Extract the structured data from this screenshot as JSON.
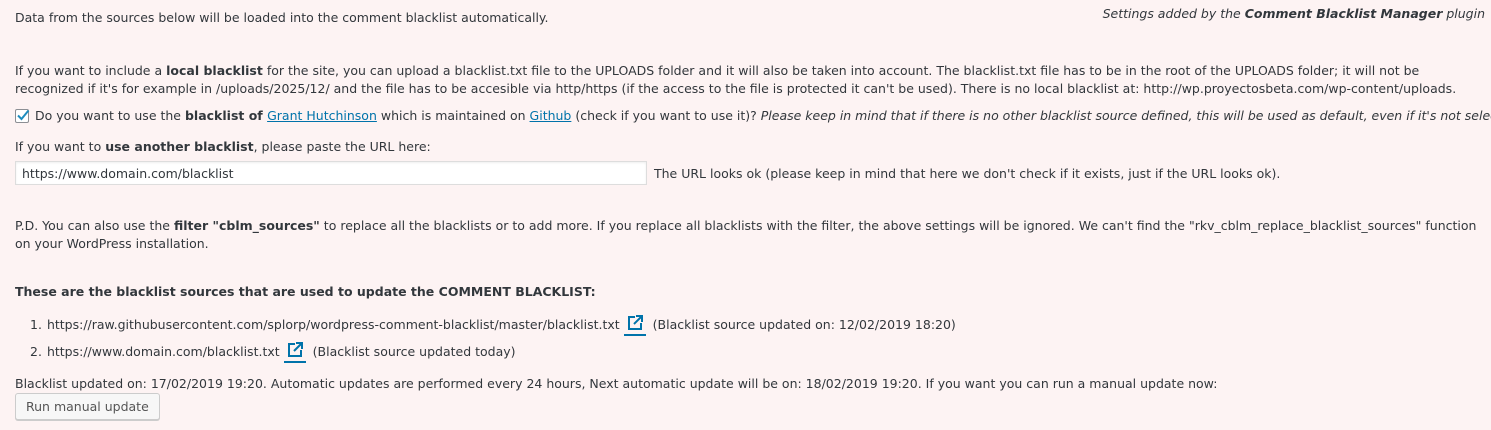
{
  "intro": "Data from the sources below will be loaded into the comment blacklist automatically.",
  "credit": {
    "prefix": "Settings added by the ",
    "plugin_name": "Comment Blacklist Manager",
    "suffix": " plugin"
  },
  "local": {
    "t1": "If you want to include a ",
    "b1": "local blacklist",
    "t2": " for the site, you can upload a blacklist.txt file to the UPLOADS folder and it will also be taken into account. The blacklist.txt file has to be in the root of the UPLOADS folder; it will not be recognized if it's for example in /uploads/2025/12/ and the file has to be accesible via http/https (if the access to the file is protected it can't be used). There is no local blacklist at: http://wp.proyectosbeta.com/wp-content/uploads."
  },
  "grant": {
    "checked": true,
    "t1": "Do you want to use the ",
    "b1": "blacklist of ",
    "link1": "Grant Hutchinson",
    "t2": " which is maintained on ",
    "link2": "Github",
    "t3": " (check if you want to use it)? ",
    "note": "Please keep in mind that if there is no other blacklist source defined, this will be used as default, even if it's not selected."
  },
  "another": {
    "t1": "If you want to ",
    "b1": "use another blacklist",
    "t2": ", please paste the URL here:",
    "input_value": "https://www.domain.com/blacklist",
    "status": "The URL looks ok (please keep in mind that here we don't check if it exists, just if the URL looks ok)."
  },
  "pd": {
    "t1": "P.D. You can also use the ",
    "b1": "filter \"cblm_sources\"",
    "t2": " to replace all the blacklists or to add more. If you replace all blacklists with the filter, the above settings will be ignored. We can't find the \"rkv_cblm_replace_blacklist_sources\" function on your WordPress installation."
  },
  "sources_heading": "These are the blacklist sources that are used to update the COMMENT BLACKLIST:",
  "sources": [
    {
      "num": "1.",
      "url": "https://raw.githubusercontent.com/splorp/wordpress-comment-blacklist/master/blacklist.txt",
      "status": "(Blacklist source updated on: 12/02/2019 18:20)"
    },
    {
      "num": "2.",
      "url": "https://www.domain.com/blacklist.txt",
      "status": "(Blacklist source updated today)"
    }
  ],
  "update_info": "Blacklist updated on: 17/02/2019 19:20. Automatic updates are performed every 24 hours, Next automatic update will be on: 18/02/2019 19:20. If you want you can run a manual update now:",
  "button_label": "Run manual update",
  "colors": {
    "link": "#0073aa",
    "background": "#fdf3f3",
    "text": "#32373c"
  },
  "icons": [
    "checkmark-icon",
    "external-link-icon"
  ]
}
